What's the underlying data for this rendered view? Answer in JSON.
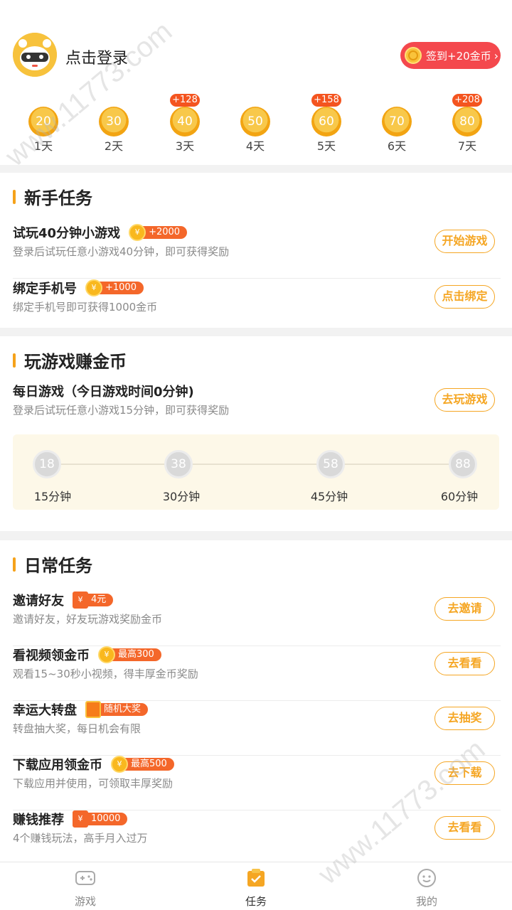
{
  "header": {
    "login_text": "点击登录",
    "signin_label": "签到+20金币",
    "days": [
      {
        "coins": "20",
        "label": "1天",
        "bonus": ""
      },
      {
        "coins": "30",
        "label": "2天",
        "bonus": ""
      },
      {
        "coins": "40",
        "label": "3天",
        "bonus": "+128"
      },
      {
        "coins": "50",
        "label": "4天",
        "bonus": ""
      },
      {
        "coins": "60",
        "label": "5天",
        "bonus": "+158"
      },
      {
        "coins": "70",
        "label": "6天",
        "bonus": ""
      },
      {
        "coins": "80",
        "label": "7天",
        "bonus": "+208"
      }
    ]
  },
  "newbie": {
    "title": "新手任务",
    "tasks": [
      {
        "name": "试玩40分钟小游戏",
        "badge": "+2000",
        "desc": "登录后试玩任意小游戏40分钟，即可获得奖励",
        "button": "开始游戏"
      },
      {
        "name": "绑定手机号",
        "badge": "+1000",
        "desc": "绑定手机号即可获得1000金币",
        "button": "点击绑定"
      }
    ]
  },
  "play": {
    "title": "玩游戏赚金币",
    "task": {
      "name": "每日游戏（今日游戏时间0分钟)",
      "desc": "登录后试玩任意小游戏15分钟，即可获得奖励",
      "button": "去玩游戏"
    },
    "milestones": [
      {
        "coins": "18",
        "label": "15分钟"
      },
      {
        "coins": "38",
        "label": "30分钟"
      },
      {
        "coins": "58",
        "label": "45分钟"
      },
      {
        "coins": "88",
        "label": "60分钟"
      }
    ]
  },
  "daily": {
    "title": "日常任务",
    "tasks": [
      {
        "name": "邀请好友",
        "badge": "4元",
        "desc": "邀请好友，好友玩游戏奖励金币",
        "button": "去邀请"
      },
      {
        "name": "看视频领金币",
        "badge": "最高300",
        "desc": "观看15~30秒小视频，得丰厚金币奖励",
        "button": "去看看"
      },
      {
        "name": "幸运大转盘",
        "badge": "随机大奖",
        "desc": "转盘抽大奖，每日机会有限",
        "button": "去抽奖"
      },
      {
        "name": "下载应用领金币",
        "badge": "最高500",
        "desc": "下载应用并使用，可领取丰厚奖励",
        "button": "去下载"
      },
      {
        "name": "赚钱推荐",
        "badge": "10000",
        "desc": "4个赚钱玩法，高手月入过万",
        "button": "去看看"
      }
    ]
  },
  "tabbar": {
    "tabs": [
      {
        "label": "游戏"
      },
      {
        "label": "任务"
      },
      {
        "label": "我的"
      }
    ]
  },
  "watermark": "www.11773.com",
  "colors": {
    "accent": "#f5a623",
    "signin": "#f4484d",
    "badge": "#f4672a"
  }
}
